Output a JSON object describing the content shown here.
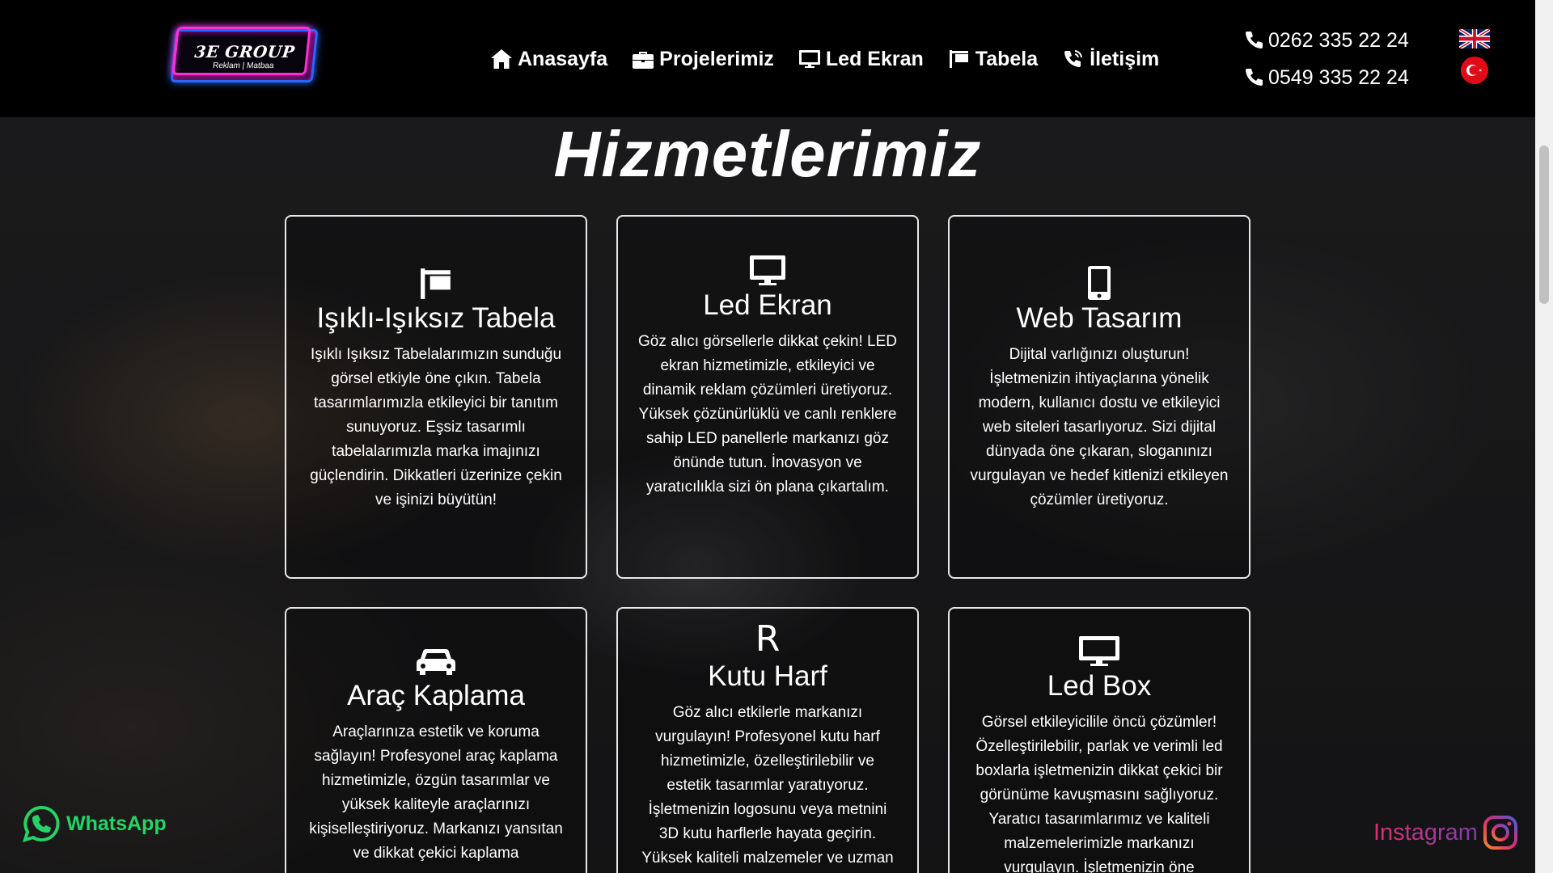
{
  "header": {
    "logo": {
      "title": "3E GROUP",
      "subtitle": "Reklam | Matbaa"
    },
    "nav": [
      {
        "label": "Anasayfa",
        "icon": "home-icon"
      },
      {
        "label": "Projelerimiz",
        "icon": "briefcase-icon"
      },
      {
        "label": "Led Ekran",
        "icon": "monitor-icon"
      },
      {
        "label": "Tabela",
        "icon": "sign-icon"
      },
      {
        "label": "İletişim",
        "icon": "phone-volume-icon"
      }
    ],
    "phones": [
      "0262 335 22 24",
      "0549 335 22 24"
    ],
    "languages": [
      "English",
      "Türkçe"
    ]
  },
  "main": {
    "title": "Hizmetlerimiz",
    "cards": [
      {
        "icon": "sign-icon",
        "title": "Işıklı-Işıksız Tabela",
        "text": "Işıklı Işıksız Tabelalarımızın sunduğu görsel etkiyle öne çıkın. Tabela tasarımlarımızla etkileyici bir tanıtım sunuyoruz. Eşsiz tasarımlı tabelalarımızla marka imajınızı güçlendirin. Dikkatleri üzerinize çekin ve işinizi büyütün!"
      },
      {
        "icon": "monitor-icon",
        "title": "Led Ekran",
        "text": "Göz alıcı görsellerle dikkat çekin! LED ekran hizmetimizle, etkileyici ve dinamik reklam çözümleri üretiyoruz. Yüksek çözünürlüklü ve canlı renklere sahip LED panellerle markanızı göz önünde tutun. İnovasyon ve yaratıcılıkla sizi ön plana çıkartalım."
      },
      {
        "icon": "mobile-icon",
        "title": "Web Tasarım",
        "text": "Dijital varlığınızı oluşturun! İşletmenizin ihtiyaçlarına yönelik modern, kullanıcı dostu ve etkileyici web siteleri tasarlıyoruz. Sizi dijital dünyada öne çıkaran, sloganınızı vurgulayan ve hedef kitlenizi etkileyen çözümler üretiyoruz."
      },
      {
        "icon": "car-icon",
        "title": "Araç Kaplama",
        "text": "Araçlarınıza estetik ve koruma sağlayın! Profesyonel araç kaplama hizmetimizle, özgün tasarımlar ve yüksek kaliteyle araçlarınızı kişiselleştiriyoruz. Markanızı yansıtan ve dikkat çekici kaplama"
      },
      {
        "icon": "letter-r-icon",
        "icon_text": "R",
        "title": "Kutu Harf",
        "text": "Göz alıcı etkilerle markanızı vurgulayın! Profesyonel kutu harf hizmetimizle, özelleştirilebilir ve estetik tasarımlar yaratıyoruz. İşletmenizin logosunu veya metnini 3D kutu harflerle hayata geçirin. Yüksek kaliteli malzemeler ve uzman"
      },
      {
        "icon": "monitor-icon",
        "title": "Led Box",
        "text": "Görsel etkileyicilile öncü çözümler! Özelleştirilebilir, parlak ve verimli led boxlarla işletmenizin dikkat çekici bir görünüme kavuşmasını sağlıyoruz. Yaratıcı tasarımlarımız ve kaliteli malzemelerimizle markanızı vurgulayın. İşletmenizin öne"
      }
    ]
  },
  "floating": {
    "whatsapp": "WhatsApp",
    "instagram": "Instagram"
  },
  "colors": {
    "header_bg": "#000000",
    "whatsapp_green": "#25d366",
    "instagram_gradient": [
      "#e1306c",
      "#833ab4"
    ]
  }
}
